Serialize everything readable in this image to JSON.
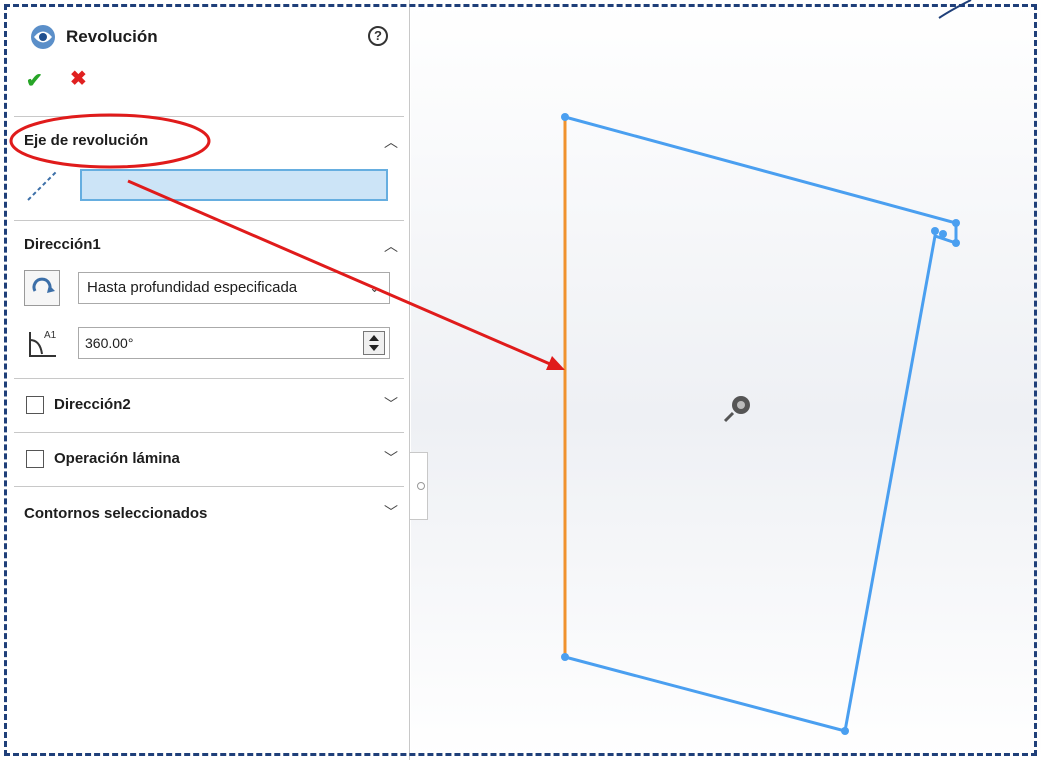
{
  "panel": {
    "title": "Revolución",
    "help": "?",
    "ok": "✔",
    "cancel": "✖",
    "sections": {
      "axis": {
        "title": "Eje de revolución"
      },
      "dir1": {
        "title": "Dirección1",
        "end_condition": "Hasta profundidad especificada",
        "angle": "360.00°"
      },
      "dir2": {
        "title": "Dirección2"
      },
      "thin": {
        "title": "Operación lámina"
      },
      "contours": {
        "title": "Contornos seleccionados"
      }
    }
  },
  "colors": {
    "sketch_line": "#4a9ff0",
    "axis_line": "#f0922e",
    "annotation_red": "#e01b1b",
    "selected_field": "#cce4f7"
  }
}
